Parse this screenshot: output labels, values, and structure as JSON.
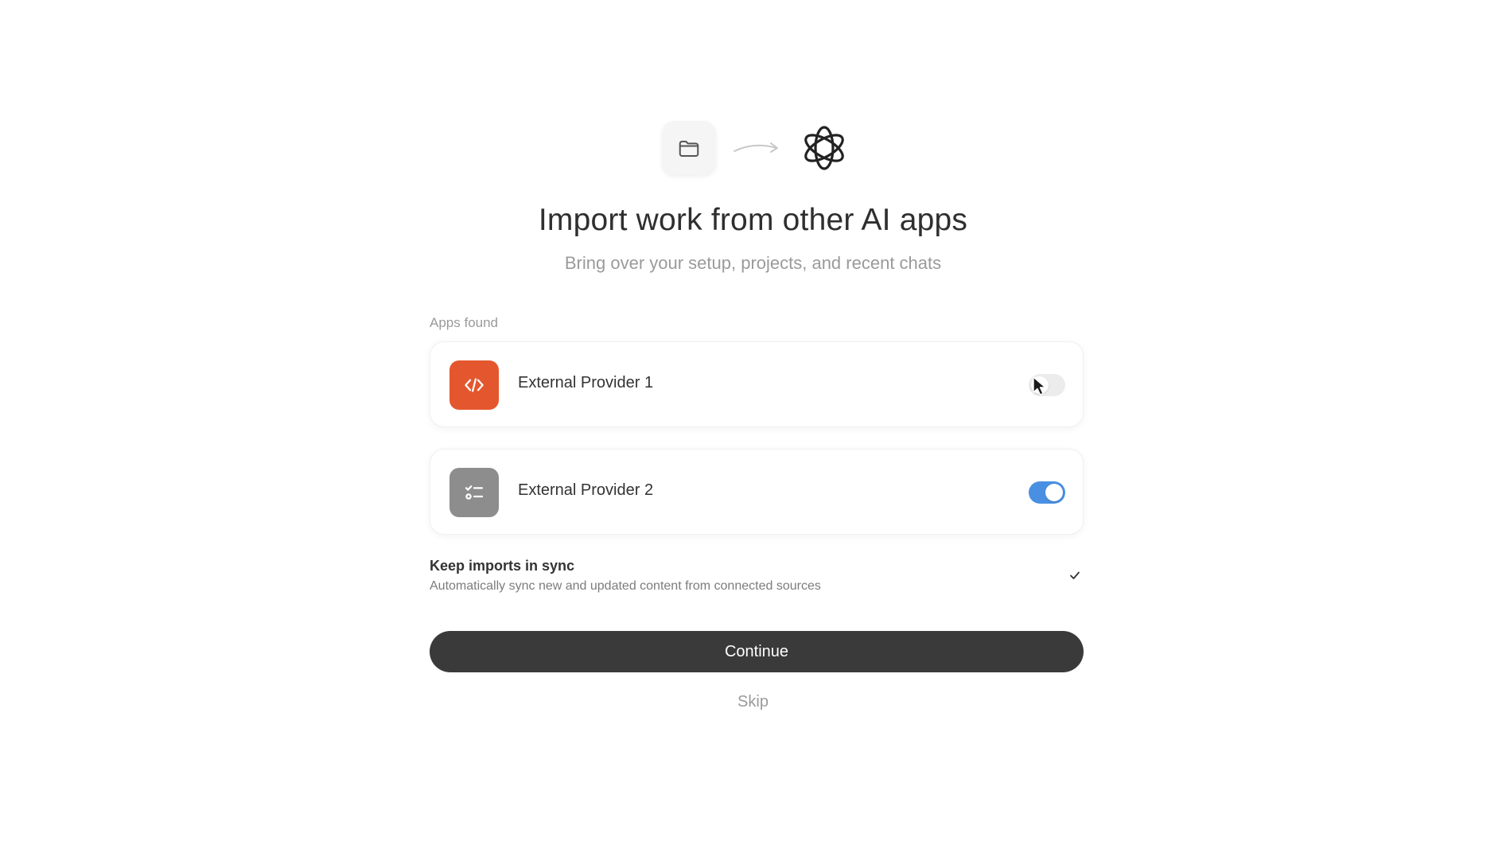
{
  "header": {
    "title": "Import work from other AI apps",
    "subtitle": "Bring over your setup, projects, and recent chats"
  },
  "apps_section": {
    "label": "Apps found",
    "items": [
      {
        "name": "External Provider 1",
        "icon": "code-brackets-icon",
        "icon_color": "#e4572e",
        "enabled": false
      },
      {
        "name": "External Provider 2",
        "icon": "checklist-icon",
        "icon_color": "#8d8d8d",
        "enabled": true
      }
    ]
  },
  "sync": {
    "title": "Keep imports in sync",
    "description": "Automatically sync new and updated content from connected sources",
    "checked": true
  },
  "actions": {
    "continue_label": "Continue",
    "skip_label": "Skip"
  },
  "colors": {
    "toggle_on": "#4a90e2",
    "primary_button": "#3a3a3a"
  }
}
